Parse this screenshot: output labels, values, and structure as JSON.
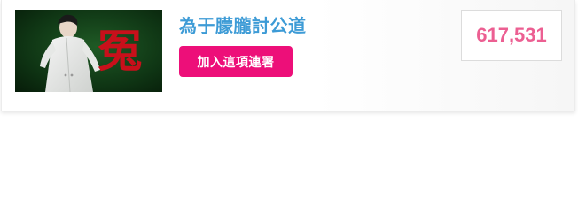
{
  "petition": {
    "title": "為于朦朧討公道",
    "join_label": "加入這項連署",
    "signature_count": "617,531",
    "thumbnail": {
      "glyph": "冤"
    }
  },
  "colors": {
    "title": "#3d9bd6",
    "button_bg": "#ed0f79",
    "button_text": "#ffffff",
    "count": "#ec5f92",
    "thumbnail_bg": "#0d2a12",
    "thumbnail_glyph": "#c8101b"
  },
  "icons": {
    "thumbnail": "petition-photo"
  }
}
